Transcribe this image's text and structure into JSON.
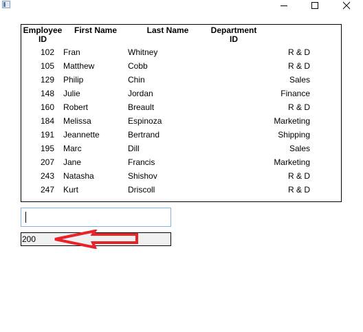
{
  "colors": {
    "annotation_arrow": "#e8232a",
    "input_border": "#7eb4ea"
  },
  "titlebar": {
    "icons": [
      "app-icon",
      "minimize-icon",
      "maximize-icon",
      "close-icon"
    ]
  },
  "table": {
    "headers": {
      "id": "Employee\nID",
      "first": "First Name",
      "last": "Last Name",
      "dept": "Department\nID"
    },
    "rows": [
      {
        "id": "102",
        "first": "Fran",
        "last": "Whitney",
        "dept": "R & D"
      },
      {
        "id": "105",
        "first": "Matthew",
        "last": "Cobb",
        "dept": "R & D"
      },
      {
        "id": "129",
        "first": "Philip",
        "last": "Chin",
        "dept": "Sales"
      },
      {
        "id": "148",
        "first": "Julie",
        "last": "Jordan",
        "dept": "Finance"
      },
      {
        "id": "160",
        "first": "Robert",
        "last": "Breault",
        "dept": "R & D"
      },
      {
        "id": "184",
        "first": "Melissa",
        "last": "Espinoza",
        "dept": "Marketing"
      },
      {
        "id": "191",
        "first": "Jeannette",
        "last": "Bertrand",
        "dept": "Shipping"
      },
      {
        "id": "195",
        "first": "Marc",
        "last": "Dill",
        "dept": "Sales"
      },
      {
        "id": "207",
        "first": "Jane",
        "last": "Francis",
        "dept": "Marketing"
      },
      {
        "id": "243",
        "first": "Natasha",
        "last": "Shishov",
        "dept": "R & D"
      },
      {
        "id": "247",
        "first": "Kurt",
        "last": "Driscoll",
        "dept": "R & D"
      }
    ]
  },
  "input": {
    "value": ""
  },
  "result": {
    "value": "200"
  }
}
